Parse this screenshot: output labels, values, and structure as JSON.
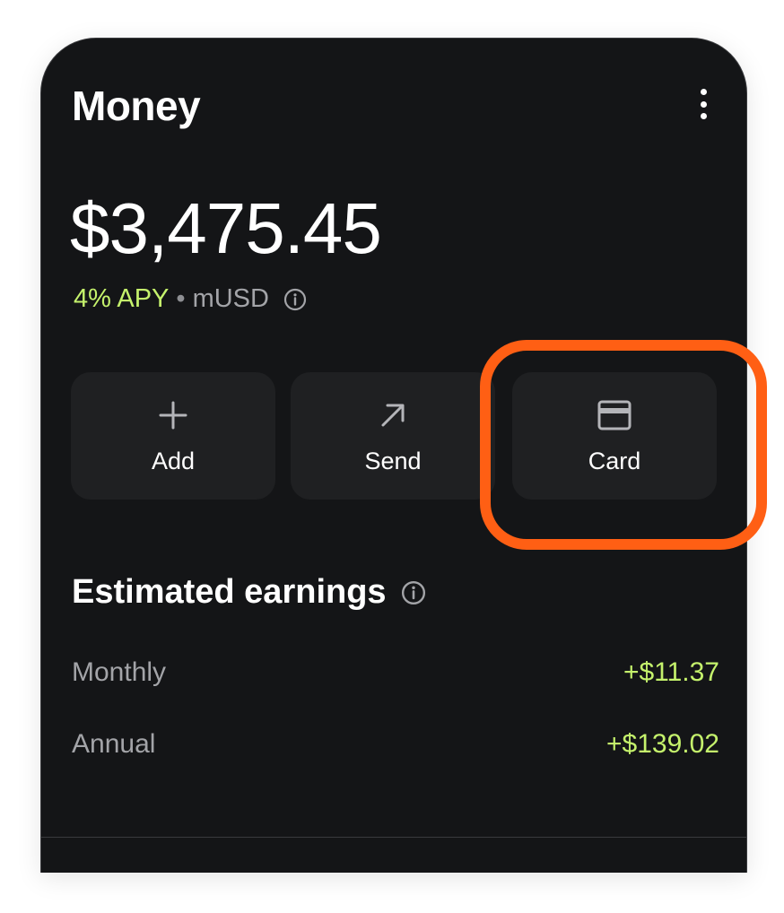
{
  "header": {
    "title": "Money",
    "menu_icon": "more-vertical-icon"
  },
  "balance": {
    "amount": "$3,475.45",
    "apy": "4% APY",
    "separator": "•",
    "currency": "mUSD",
    "info_icon": "info-icon"
  },
  "actions": [
    {
      "label": "Add",
      "icon": "plus-icon"
    },
    {
      "label": "Send",
      "icon": "arrow-up-right-icon"
    },
    {
      "label": "Card",
      "icon": "credit-card-icon"
    }
  ],
  "highlight": {
    "target": "Card",
    "color": "#ff5f14"
  },
  "earnings": {
    "title": "Estimated earnings",
    "rows": [
      {
        "label": "Monthly",
        "value": "+$11.37"
      },
      {
        "label": "Annual",
        "value": "+$139.02"
      }
    ]
  },
  "colors": {
    "background": "#141517",
    "button": "#1f2022",
    "accent_green": "#c5f26c",
    "muted_text": "#a3a4a8"
  }
}
